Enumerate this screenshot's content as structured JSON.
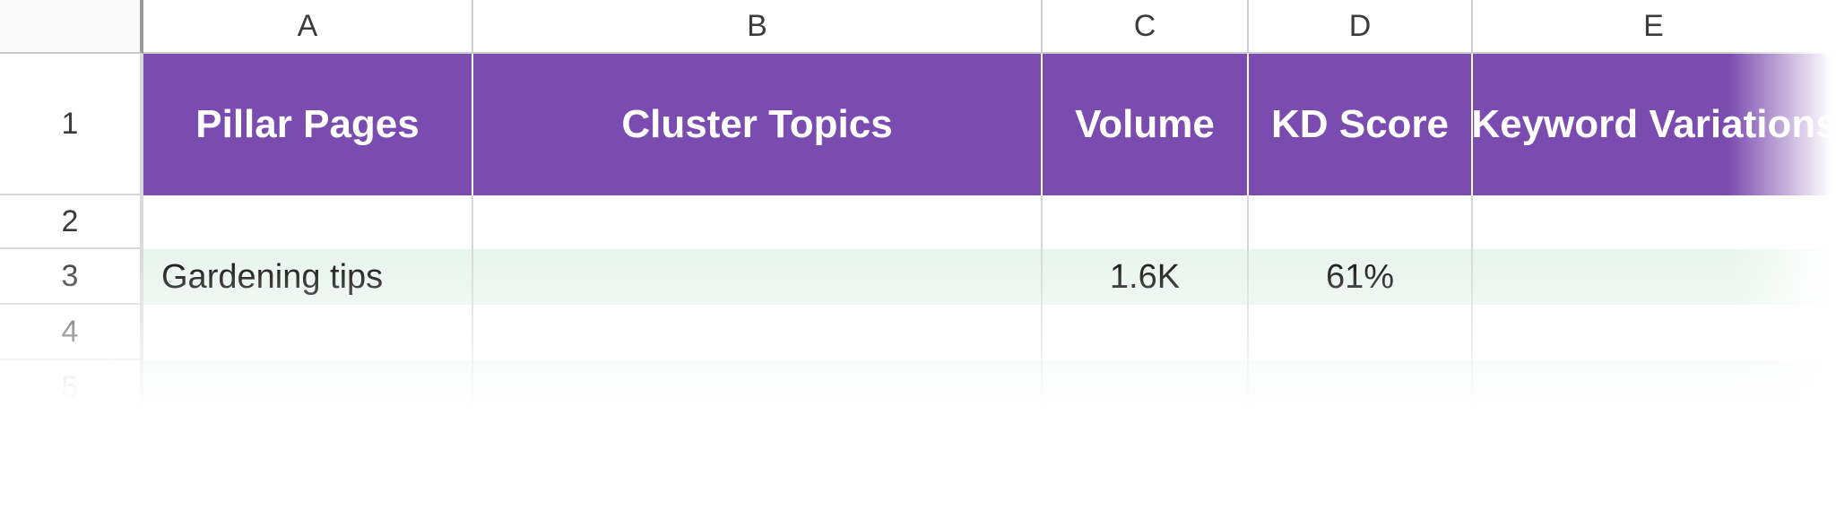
{
  "columns": {
    "A": "A",
    "B": "B",
    "C": "C",
    "D": "D",
    "E": "E"
  },
  "rowNumbers": {
    "r1": "1",
    "r2": "2",
    "r3": "3",
    "r4": "4",
    "r5": "5"
  },
  "header": {
    "A": "Pillar Pages",
    "B": "Cluster Topics",
    "C": "Volume",
    "D": "KD Score",
    "E": "Keyword Variations"
  },
  "rows": {
    "r3": {
      "A": "Gardening tips",
      "B": "",
      "C": "1.6K",
      "D": "61%",
      "E": ""
    }
  },
  "colors": {
    "headerFill": "#7b4caf",
    "headerText": "#ffffff",
    "altRowFill": "#e8f5ec"
  }
}
